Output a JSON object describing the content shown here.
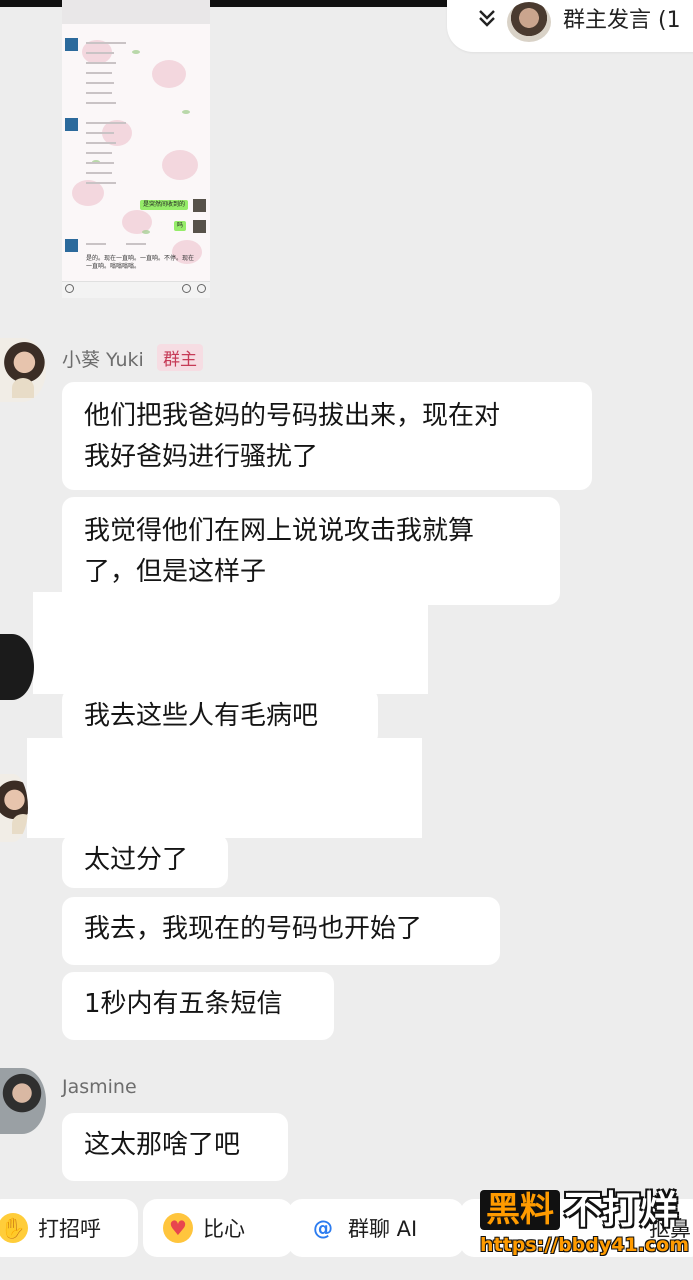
{
  "top_pill": {
    "label": "群主发言 (1"
  },
  "screenshot_thumb": {
    "green_bubble_1": "是突然间收到的",
    "green_bubble_2": "吗",
    "message_text": "是的。现在一直响。一直响。不停。现在一直响。嗡嗡嗡嗡。"
  },
  "messages": [
    {
      "sender": "小葵 Yuki",
      "badge": "群主"
    },
    {
      "text_1": "他们把我爸妈的号码拔出来，现在对",
      "text_2": "我好爸妈进行骚扰了"
    },
    {
      "text_1": "我觉得他们在网上说说攻击我就算",
      "text_2": "了，但是这样子"
    },
    {
      "text": "我去这些人有毛病吧"
    },
    {
      "text": "太过分了"
    },
    {
      "text": "我去，我现在的号码也开始了"
    },
    {
      "text": "1秒内有五条短信"
    },
    {
      "sender": "Jasmine"
    },
    {
      "text": "这太那啥了吧"
    }
  ],
  "quick_actions": [
    {
      "label": "打招呼",
      "icon": "wave-icon"
    },
    {
      "label": "比心",
      "icon": "heart-hand-icon"
    },
    {
      "label": "群聊 AI",
      "icon": "at-icon"
    },
    {
      "label": "抠鼻",
      "icon": "emoji-icon"
    }
  ],
  "watermark": {
    "brand": "黑料",
    "slogan": "不打烊",
    "url": "https://bbdy41.com"
  },
  "colors": {
    "background": "#ededed",
    "bubble": "#ffffff",
    "badge_text": "#c63b57",
    "badge_bg": "#f6dde3",
    "wechat_green": "#95ec69"
  }
}
